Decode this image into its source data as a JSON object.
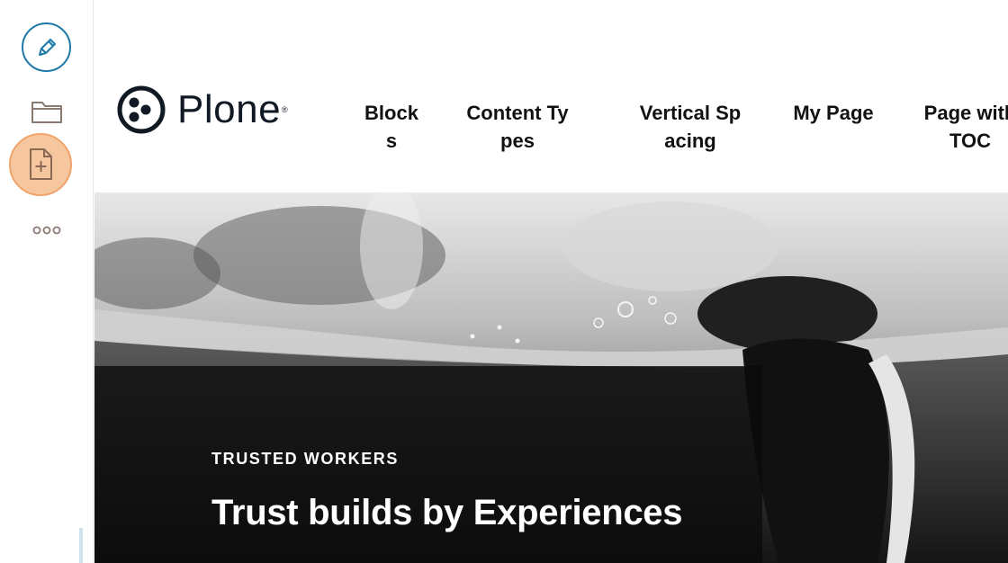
{
  "toolbar": {
    "edit_icon": "pencil-icon",
    "contents_icon": "folder-icon",
    "add_icon": "add-document-icon",
    "more_icon": "more-dots-icon",
    "accent": "#1f7aa8",
    "add_highlight": "#f6c79f"
  },
  "logo": {
    "text": "Plone",
    "mark": "®"
  },
  "nav": {
    "items": [
      {
        "label": "Blocks"
      },
      {
        "label": "Content Types"
      },
      {
        "label": "Vertical Spacing"
      },
      {
        "label": "My Page"
      },
      {
        "label": "Page with TOC"
      }
    ]
  },
  "hero": {
    "kicker": "TRUSTED WORKERS",
    "title": "Trust builds by Experiences"
  }
}
